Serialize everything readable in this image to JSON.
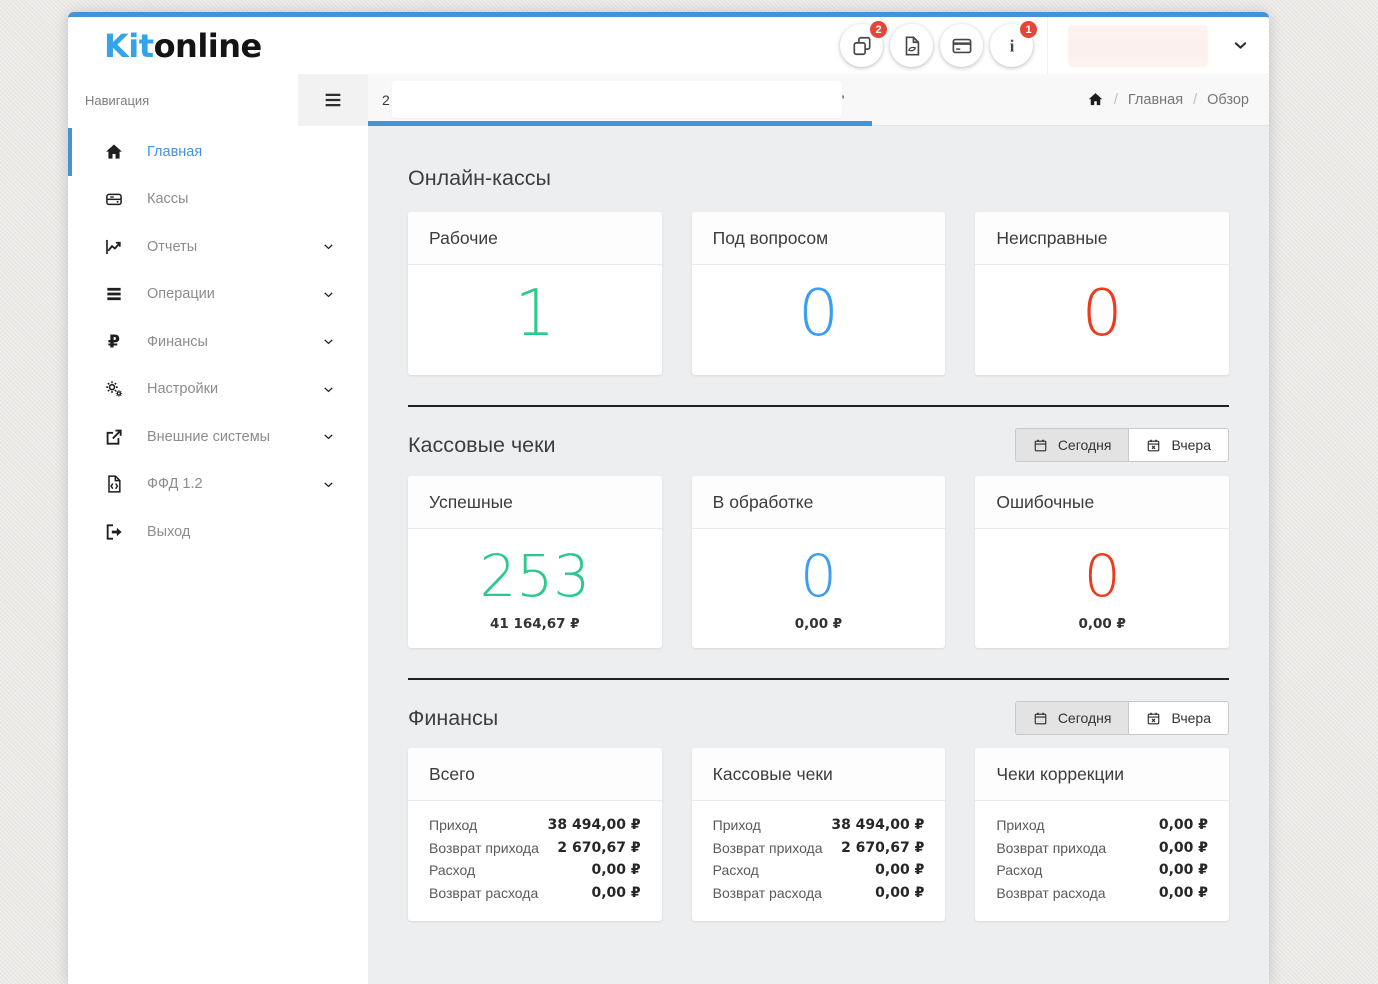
{
  "colors": {
    "accent": "#4593d7",
    "green": "#2bc98c",
    "blue": "#3d9df0",
    "red": "#ee3b1c",
    "badge_red": "#e2473a"
  },
  "brand": {
    "logo_primary": "Kit",
    "logo_secondary": "online"
  },
  "header": {
    "buttons": [
      {
        "id": "copy-docs",
        "icon": "copy-icon",
        "badge": "2"
      },
      {
        "id": "pdf-export",
        "icon": "pdf-icon",
        "badge": null
      },
      {
        "id": "payment-card",
        "icon": "credit-card-icon",
        "badge": null
      },
      {
        "id": "info",
        "icon": "info-icon",
        "badge": "1"
      }
    ]
  },
  "toolbar": {
    "nav_label": "Навигация",
    "fragment_left": "2",
    "fragment_right": "'",
    "breadcrumb": {
      "separator": "/",
      "items": [
        "Главная",
        "Обзор"
      ]
    }
  },
  "sidebar": {
    "items": [
      {
        "id": "home",
        "label": "Главная",
        "icon": "home-icon",
        "active": true,
        "chevron": false
      },
      {
        "id": "kassy",
        "label": "Кассы",
        "icon": "cash-register-icon",
        "active": false,
        "chevron": false
      },
      {
        "id": "reports",
        "label": "Отчеты",
        "icon": "reports-icon",
        "active": false,
        "chevron": true
      },
      {
        "id": "operations",
        "label": "Операции",
        "icon": "operations-icon",
        "active": false,
        "chevron": true
      },
      {
        "id": "finances",
        "label": "Финансы",
        "icon": "finances-icon",
        "active": false,
        "chevron": true
      },
      {
        "id": "settings",
        "label": "Настройки",
        "icon": "settings-icon",
        "active": false,
        "chevron": true
      },
      {
        "id": "external-systems",
        "label": "Внешние системы",
        "icon": "external-systems-icon",
        "active": false,
        "chevron": true
      },
      {
        "id": "ffd",
        "label": "ФФД 1.2",
        "icon": "ffd-icon",
        "active": false,
        "chevron": true
      },
      {
        "id": "logout",
        "label": "Выход",
        "icon": "logout-icon",
        "active": false,
        "chevron": false
      }
    ]
  },
  "sections": {
    "overview": {
      "title": "Онлайн-кассы",
      "cards": [
        {
          "title": "Рабочие",
          "value": "1",
          "color": "green"
        },
        {
          "title": "Под вопросом",
          "value": "0",
          "color": "blue"
        },
        {
          "title": "Неисправные",
          "value": "0",
          "color": "red"
        }
      ]
    },
    "receipts": {
      "title": "Кассовые чеки",
      "period_buttons": [
        {
          "id": "today",
          "label": "Сегодня",
          "icon": "calendar-icon",
          "active": true
        },
        {
          "id": "yesterday",
          "label": "Вчера",
          "icon": "calendar-x-icon",
          "active": false
        }
      ],
      "cards": [
        {
          "title": "Успешные",
          "value": "253",
          "amount": "41 164,67 ₽",
          "color": "green"
        },
        {
          "title": "В обработке",
          "value": "0",
          "amount": "0,00 ₽",
          "color": "blue"
        },
        {
          "title": "Ошибочные",
          "value": "0",
          "amount": "0,00 ₽",
          "color": "red"
        }
      ]
    },
    "finances": {
      "title": "Финансы",
      "period_buttons": [
        {
          "id": "today",
          "label": "Сегодня",
          "icon": "calendar-icon",
          "active": true
        },
        {
          "id": "yesterday",
          "label": "Вчера",
          "icon": "calendar-x-icon",
          "active": false
        }
      ],
      "cards": [
        {
          "title": "Всего",
          "rows": [
            {
              "label": "Приход",
              "value": "38 494,00 ₽"
            },
            {
              "label": "Возврат прихода",
              "value": "2 670,67 ₽"
            },
            {
              "label": "Расход",
              "value": "0,00 ₽"
            },
            {
              "label": "Возврат расхода",
              "value": "0,00 ₽"
            }
          ]
        },
        {
          "title": "Кассовые чеки",
          "rows": [
            {
              "label": "Приход",
              "value": "38 494,00 ₽"
            },
            {
              "label": "Возврат прихода",
              "value": "2 670,67 ₽"
            },
            {
              "label": "Расход",
              "value": "0,00 ₽"
            },
            {
              "label": "Возврат расхода",
              "value": "0,00 ₽"
            }
          ]
        },
        {
          "title": "Чеки коррекции",
          "rows": [
            {
              "label": "Приход",
              "value": "0,00 ₽"
            },
            {
              "label": "Возврат прихода",
              "value": "0,00 ₽"
            },
            {
              "label": "Расход",
              "value": "0,00 ₽"
            },
            {
              "label": "Возврат расхода",
              "value": "0,00 ₽"
            }
          ]
        }
      ]
    }
  }
}
